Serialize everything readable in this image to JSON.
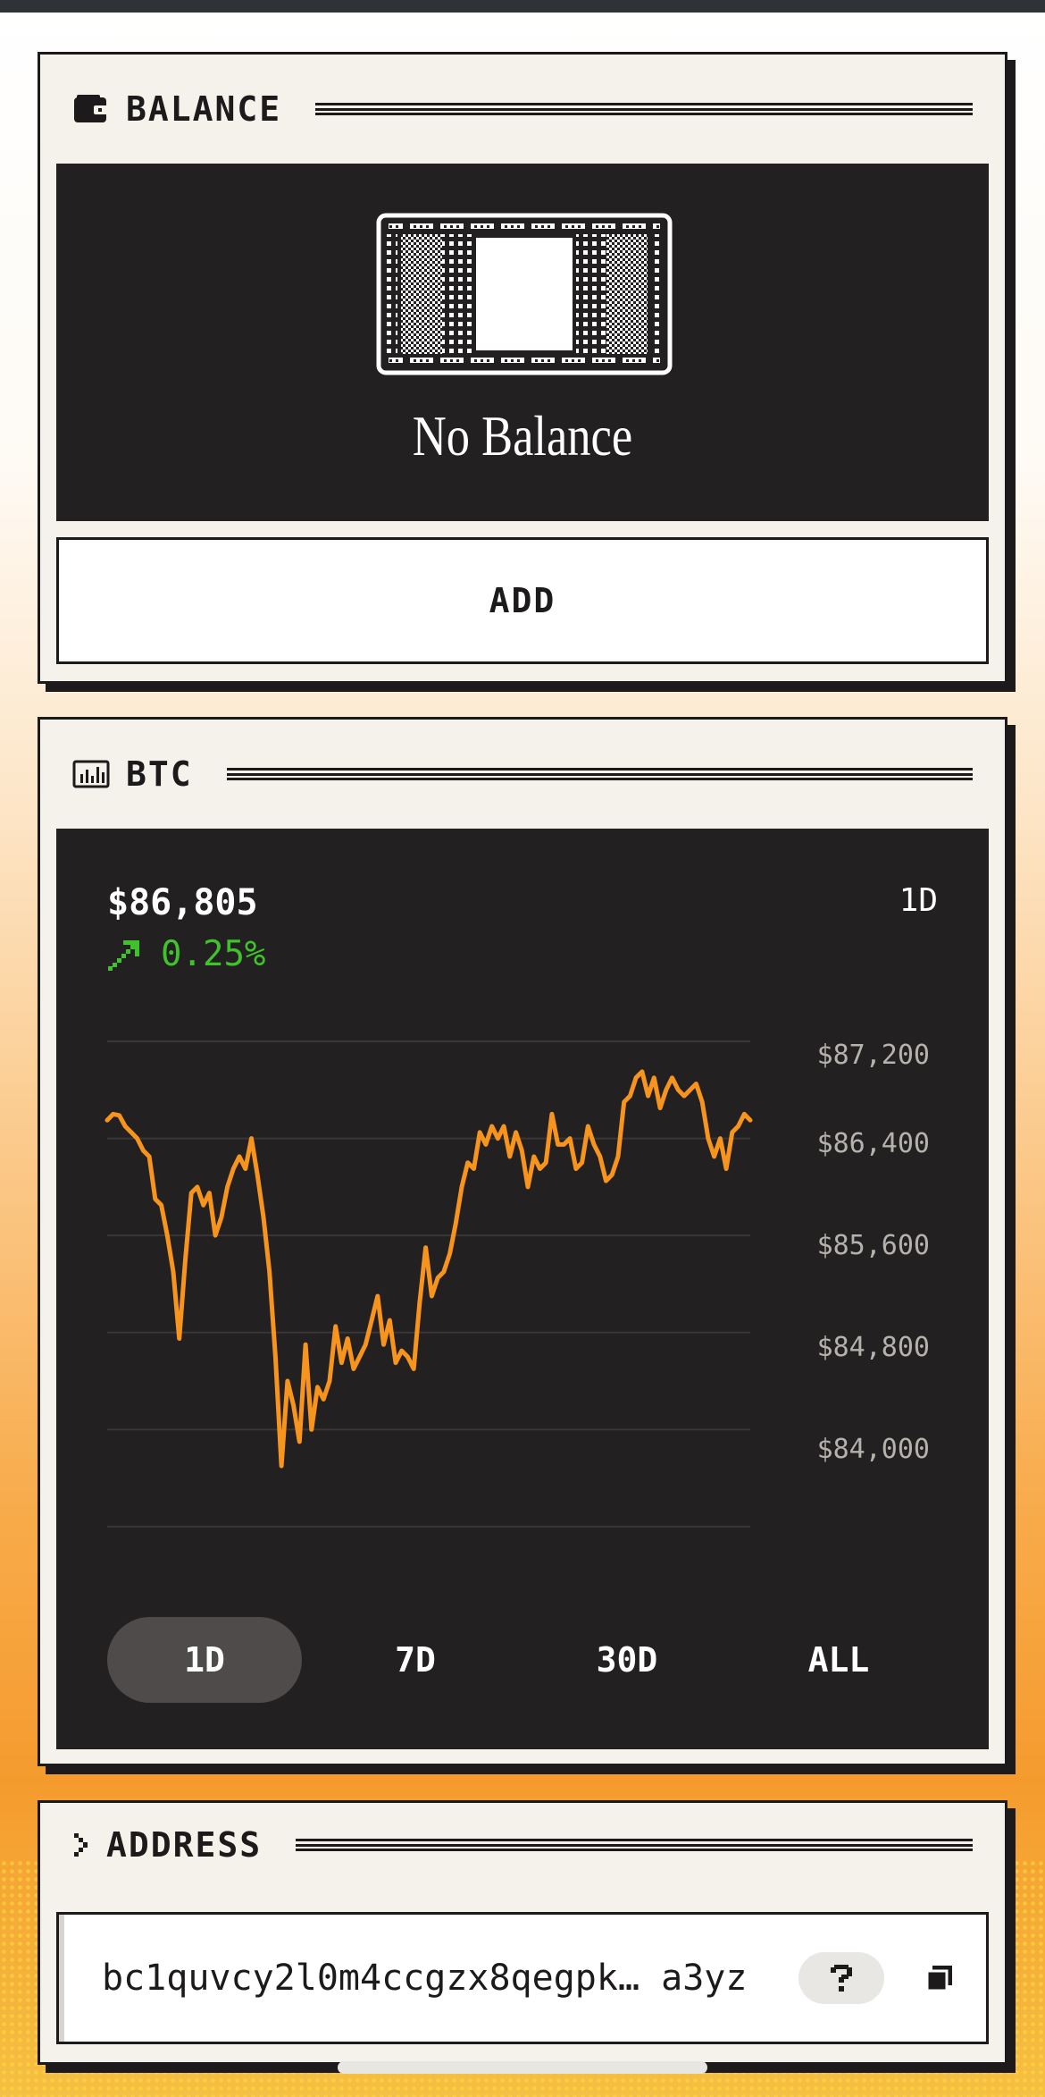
{
  "balance_card": {
    "title": "BALANCE",
    "title_icon": "wallet-icon",
    "banknote_icon": "banknote-icon",
    "empty_text": "No Balance",
    "add_label": "ADD"
  },
  "btc_card": {
    "title": "BTC",
    "title_icon": "chart-bars-icon",
    "price": "$86,805",
    "change": "0.25%",
    "change_direction": "up",
    "change_color": "#3fc22a",
    "period": "1D",
    "line_color": "#f7941d",
    "tabs": [
      {
        "label": "1D",
        "active": true
      },
      {
        "label": "7D",
        "active": false
      },
      {
        "label": "30D",
        "active": false
      },
      {
        "label": "ALL",
        "active": false
      }
    ]
  },
  "chart_data": {
    "type": "line",
    "y_tick_labels": [
      "$87,200",
      "$86,400",
      "$85,600",
      "$84,800",
      "$84,000"
    ],
    "ylim": [
      83200,
      87400
    ],
    "grid": true,
    "series": [
      {
        "values": [
          86750,
          86800,
          86790,
          86700,
          86650,
          86600,
          86500,
          86450,
          86100,
          86050,
          85800,
          85500,
          84950,
          85600,
          86150,
          86200,
          86050,
          86150,
          85800,
          85950,
          86200,
          86350,
          86450,
          86350,
          86600,
          86300,
          85950,
          85500,
          84800,
          83900,
          84600,
          84400,
          84100,
          84900,
          84200,
          84550,
          84450,
          84600,
          85050,
          84750,
          84950,
          84700,
          84800,
          84900,
          85100,
          85300,
          84900,
          85100,
          84750,
          84850,
          84800,
          84700,
          85250,
          85700,
          85300,
          85450,
          85500,
          85650,
          85900,
          86200,
          86400,
          86350,
          86650,
          86550,
          86700,
          86600,
          86700,
          86450,
          86650,
          86500,
          86200,
          86450,
          86350,
          86400,
          86800,
          86550,
          86550,
          86600,
          86350,
          86400,
          86700,
          86550,
          86450,
          86250,
          86300,
          86450,
          86900,
          86950,
          87100,
          87150,
          86950,
          87100,
          86850,
          87000,
          87100,
          87000,
          86950,
          87000,
          87050,
          86900,
          86600,
          86450,
          86600,
          86350,
          86650,
          86700,
          86800,
          86750
        ]
      }
    ]
  },
  "address_card": {
    "title": "ADDRESS",
    "title_icon": "chevron-right-icon",
    "address": "bc1quvcy2l0m4ccgzx8qegpk… a3yz",
    "help_icon": "question-icon",
    "copy_icon": "copy-icon"
  }
}
